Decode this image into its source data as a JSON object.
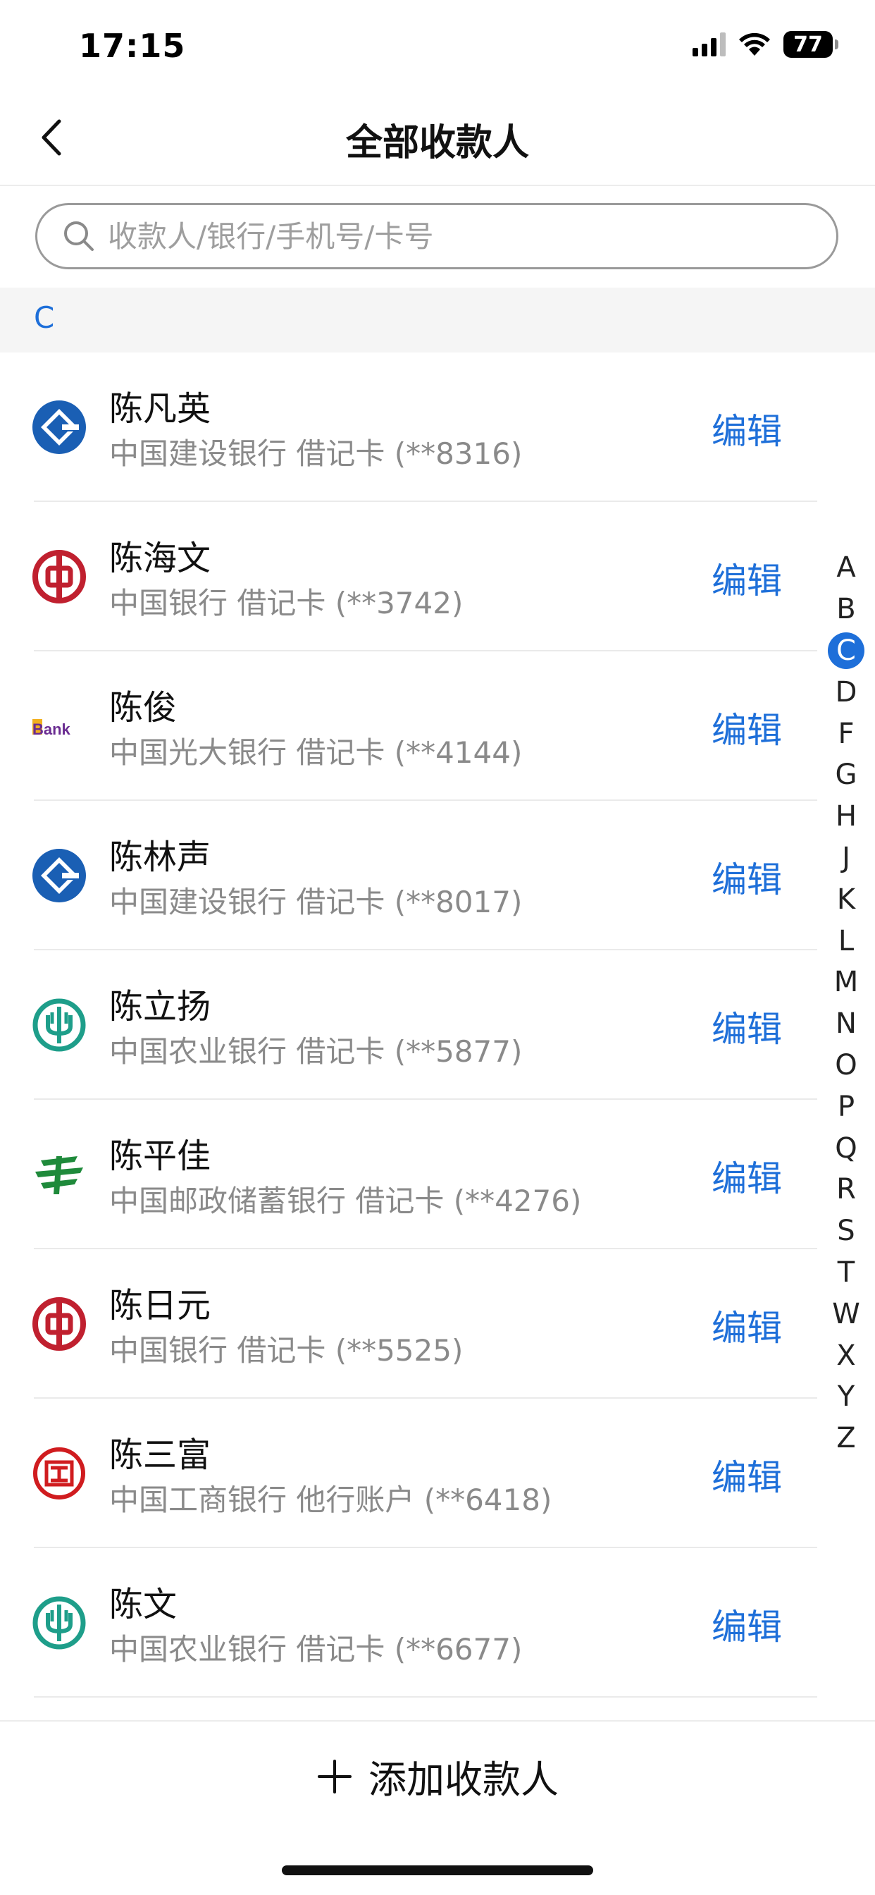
{
  "status_bar": {
    "time": "17:15",
    "battery": "77",
    "icons": [
      "signal-icon",
      "wifi-icon",
      "battery-icon"
    ]
  },
  "nav": {
    "title": "全部收款人",
    "back_icon": "chevron-left-icon"
  },
  "search": {
    "placeholder": "收款人/银行/手机号/卡号",
    "value": ""
  },
  "section": {
    "letter": "C"
  },
  "payees": [
    {
      "name": "陈凡英",
      "detail": "中国建设银行 借记卡 (**8316)",
      "logo": "ccb-logo-icon",
      "edit": "编辑"
    },
    {
      "name": "陈海文",
      "detail": "中国银行 借记卡 (**3742)",
      "logo": "boc-logo-icon",
      "edit": "编辑"
    },
    {
      "name": "陈俊",
      "detail": "中国光大银行 借记卡 (**4144)",
      "logo": "ceb-logo-icon",
      "edit": "编辑"
    },
    {
      "name": "陈林声",
      "detail": "中国建设银行 借记卡 (**8017)",
      "logo": "ccb-logo-icon",
      "edit": "编辑"
    },
    {
      "name": "陈立扬",
      "detail": "中国农业银行 借记卡 (**5877)",
      "logo": "abc-logo-icon",
      "edit": "编辑"
    },
    {
      "name": "陈平佳",
      "detail": "中国邮政储蓄银行 借记卡 (**4276)",
      "logo": "psbc-logo-icon",
      "edit": "编辑"
    },
    {
      "name": "陈日元",
      "detail": "中国银行 借记卡 (**5525)",
      "logo": "boc-logo-icon",
      "edit": "编辑"
    },
    {
      "name": "陈三富",
      "detail": "中国工商银行 他行账户 (**6418)",
      "logo": "icbc-logo-icon",
      "edit": "编辑"
    },
    {
      "name": "陈文",
      "detail": "中国农业银行 借记卡 (**6677)",
      "logo": "abc-logo-icon",
      "edit": "编辑"
    }
  ],
  "logo_text": {
    "ceb": "Bank"
  },
  "index_letters": [
    "A",
    "B",
    "C",
    "D",
    "F",
    "G",
    "H",
    "J",
    "K",
    "L",
    "M",
    "N",
    "O",
    "P",
    "Q",
    "R",
    "S",
    "T",
    "W",
    "X",
    "Y",
    "Z"
  ],
  "active_index": "C",
  "add_button": {
    "label": "添加收款人",
    "icon": "plus-icon"
  },
  "colors": {
    "accent": "#1e6fd9",
    "ccb": "#1a5fb4",
    "boc": "#c0202f",
    "abc": "#1e9e8a",
    "psbc": "#1f8a3b",
    "icbc": "#d01c1f",
    "ceb": "#6a2c91"
  }
}
